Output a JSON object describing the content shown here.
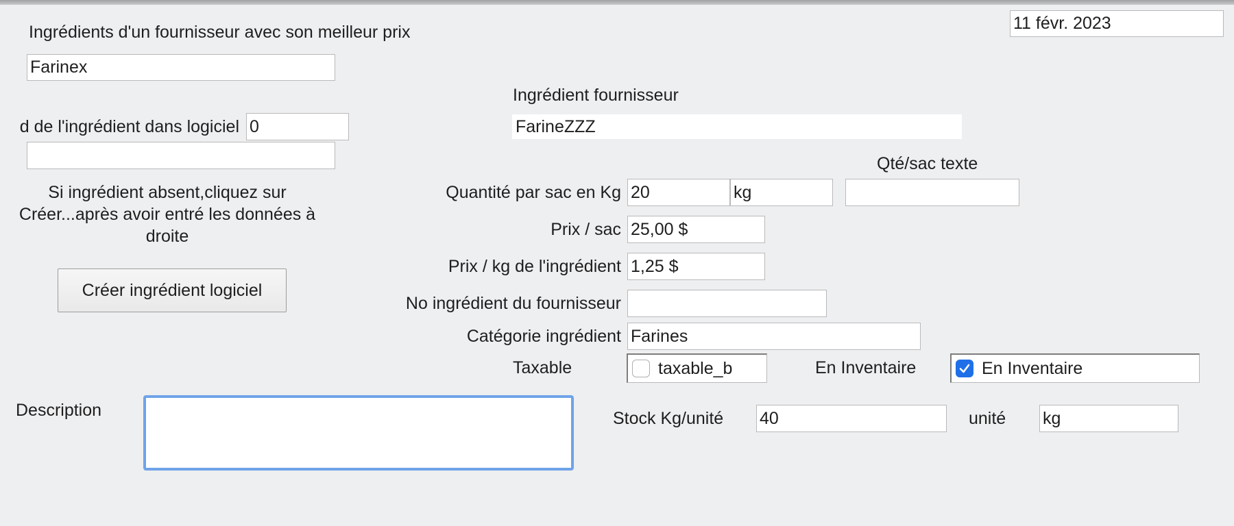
{
  "header": {
    "date": "11 févr. 2023",
    "title": "Ingrédients d'un fournisseur avec son meilleur prix"
  },
  "left": {
    "supplier_value": "Farinex",
    "id_label": "d de l'ingrédient dans logiciel",
    "id_value": "0",
    "name_value": "",
    "hint": "Si ingrédient absent,cliquez sur Créer...après avoir entré les données à droite",
    "create_button": "Créer ingrédient logiciel"
  },
  "supplier_ingredient": {
    "label": "Ingrédient fournisseur",
    "value": "FarineZZZ"
  },
  "form": {
    "qty_text_label": "Qté/sac texte",
    "qty_text_value": "",
    "qty_label": "Quantité par sac en Kg",
    "qty_value": "20",
    "qty_unit": "kg",
    "price_bag_label": "Prix / sac",
    "price_bag_value": "25,00 $",
    "price_kg_label": "Prix / kg de l'ingrédient",
    "price_kg_value": "1,25 $",
    "supplier_no_label": "No ingrédient du fournisseur",
    "supplier_no_value": "",
    "category_label": "Catégorie ingrédient",
    "category_value": "Farines",
    "taxable_label": "Taxable",
    "taxable_checkbox_label": "taxable_b",
    "taxable_checked": false,
    "inventory_label": "En Inventaire",
    "inventory_checkbox_label": "En Inventaire",
    "inventory_checked": true
  },
  "description": {
    "label": "Description",
    "value": ""
  },
  "stock": {
    "label": "Stock Kg/unité",
    "value": "40",
    "unit_label": "unité",
    "unit_value": "kg"
  },
  "colors": {
    "background": "#eeeff1",
    "focus_ring": "#6fa3e8",
    "checkbox_accent": "#1f6fe8"
  }
}
